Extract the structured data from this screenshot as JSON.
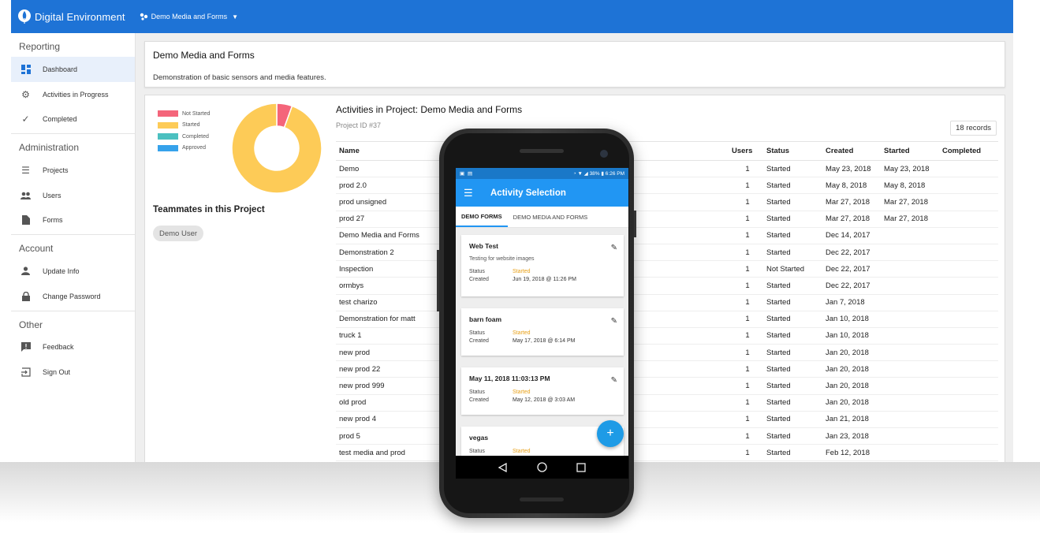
{
  "app": {
    "title": "Digital Environment",
    "project_selector": "Demo Media and Forms"
  },
  "sidebar": {
    "sections": [
      {
        "heading": "Reporting",
        "items": [
          {
            "label": "Dashboard",
            "icon": "dashboard-icon",
            "active": true
          },
          {
            "label": "Activities in Progress",
            "icon": "gear-icon"
          },
          {
            "label": "Completed",
            "icon": "check-icon"
          }
        ]
      },
      {
        "heading": "Administration",
        "items": [
          {
            "label": "Projects",
            "icon": "list-icon"
          },
          {
            "label": "Users",
            "icon": "people-icon"
          },
          {
            "label": "Forms",
            "icon": "file-icon"
          }
        ]
      },
      {
        "heading": "Account",
        "items": [
          {
            "label": "Update Info",
            "icon": "person-icon"
          },
          {
            "label": "Change Password",
            "icon": "lock-icon"
          }
        ]
      },
      {
        "heading": "Other",
        "items": [
          {
            "label": "Feedback",
            "icon": "feedback-icon"
          },
          {
            "label": "Sign Out",
            "icon": "sign-out-icon"
          }
        ]
      }
    ]
  },
  "project": {
    "title": "Demo Media and Forms",
    "description": "Demonstration of basic sensors and media features."
  },
  "status_chart": {
    "legend": [
      {
        "label": "Not Started",
        "color": "#f4657a"
      },
      {
        "label": "Started",
        "color": "#fdcb57"
      },
      {
        "label": "Completed",
        "color": "#4bc0c0"
      },
      {
        "label": "Approved",
        "color": "#36a2eb"
      }
    ],
    "values": [
      1,
      17,
      0,
      0
    ]
  },
  "team": {
    "title": "Teammates in this Project",
    "members": [
      "Demo User"
    ]
  },
  "activities": {
    "title": "Activities in Project: Demo Media and Forms",
    "project_id": "Project ID #37",
    "records": "18 records",
    "columns": [
      "Name",
      "Users",
      "Status",
      "Created",
      "Started",
      "Completed"
    ],
    "rows": [
      [
        "Demo",
        "1",
        "Started",
        "May 23, 2018",
        "May 23, 2018",
        ""
      ],
      [
        "prod 2.0",
        "1",
        "Started",
        "May 8, 2018",
        "May 8, 2018",
        ""
      ],
      [
        "prod unsigned",
        "1",
        "Started",
        "Mar 27, 2018",
        "Mar 27, 2018",
        ""
      ],
      [
        "prod 27",
        "1",
        "Started",
        "Mar 27, 2018",
        "Mar 27, 2018",
        ""
      ],
      [
        "Demo Media and Forms",
        "1",
        "Started",
        "Dec 14, 2017",
        "",
        ""
      ],
      [
        "Demonstration 2",
        "1",
        "Started",
        "Dec 22, 2017",
        "",
        ""
      ],
      [
        "Inspection",
        "1",
        "Not Started",
        "Dec 22, 2017",
        "",
        ""
      ],
      [
        "ormbys",
        "1",
        "Started",
        "Dec 22, 2017",
        "",
        ""
      ],
      [
        "test charizo",
        "1",
        "Started",
        "Jan 7, 2018",
        "",
        ""
      ],
      [
        "Demonstration for matt",
        "1",
        "Started",
        "Jan 10, 2018",
        "",
        ""
      ],
      [
        "truck 1",
        "1",
        "Started",
        "Jan 10, 2018",
        "",
        ""
      ],
      [
        "new prod",
        "1",
        "Started",
        "Jan 20, 2018",
        "",
        ""
      ],
      [
        "new prod 22",
        "1",
        "Started",
        "Jan 20, 2018",
        "",
        ""
      ],
      [
        "new prod 999",
        "1",
        "Started",
        "Jan 20, 2018",
        "",
        ""
      ],
      [
        "old prod",
        "1",
        "Started",
        "Jan 20, 2018",
        "",
        ""
      ],
      [
        "new prod 4",
        "1",
        "Started",
        "Jan 21, 2018",
        "",
        ""
      ],
      [
        "prod 5",
        "1",
        "Started",
        "Jan 23, 2018",
        "",
        ""
      ],
      [
        "test media and prod",
        "1",
        "Started",
        "Feb 12, 2018",
        "",
        ""
      ]
    ]
  },
  "phone": {
    "status_bar": {
      "battery": "38%",
      "time": "6:26 PM"
    },
    "title": "Activity Selection",
    "tabs": [
      "DEMO FORMS",
      "DEMO MEDIA AND FORMS"
    ],
    "status_label": "Status",
    "created_label": "Created",
    "cards": [
      {
        "name": "Web Test",
        "description": "Testing for website images",
        "status": "Started",
        "created": "Jun 19, 2018 @ 11:26 PM"
      },
      {
        "name": "barn foam",
        "description": "",
        "status": "Started",
        "created": "May 17, 2018 @ 6:14 PM"
      },
      {
        "name": "May 11, 2018 11:03:13 PM",
        "description": "",
        "status": "Started",
        "created": "May 12, 2018 @ 3:03 AM"
      },
      {
        "name": "vegas",
        "description": "",
        "status": "Started",
        "created": ""
      }
    ],
    "fab": "+"
  }
}
